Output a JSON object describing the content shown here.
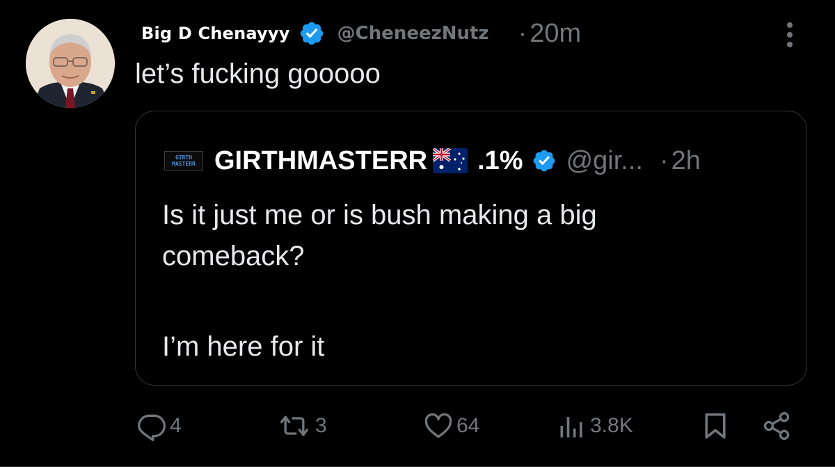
{
  "post": {
    "display_name": "Big D Chenayyy",
    "handle": "@CheneezNutz",
    "separator": "·",
    "time": "20m",
    "text": "let’s fucking gooooo"
  },
  "quoted_post": {
    "logo_text_line1": "GIRTH",
    "logo_text_line2": "MASTERR",
    "display_name": "GIRTHMASTERR",
    "name_suffix": ".1%",
    "handle": "@gir...",
    "separator": "·",
    "time": "2h",
    "text_line1": "Is it just me or is bush making a big",
    "text_line2": "comeback?",
    "text_line3": "I’m here for it"
  },
  "actions": {
    "replies": "4",
    "reposts": "3",
    "likes": "64",
    "views": "3.8K"
  },
  "icons": {
    "verified": "verified-badge-icon",
    "more": "more-vertical-icon",
    "flag": "australia-flag-icon",
    "reply": "reply-icon",
    "repost": "repost-icon",
    "like": "heart-icon",
    "views": "views-chart-icon",
    "bookmark": "bookmark-icon",
    "share": "share-icon"
  },
  "colors": {
    "background": "#000000",
    "text_primary": "#e7e9ea",
    "text_secondary": "#71767b",
    "verified_blue": "#1d9bf0",
    "border": "#333639"
  }
}
